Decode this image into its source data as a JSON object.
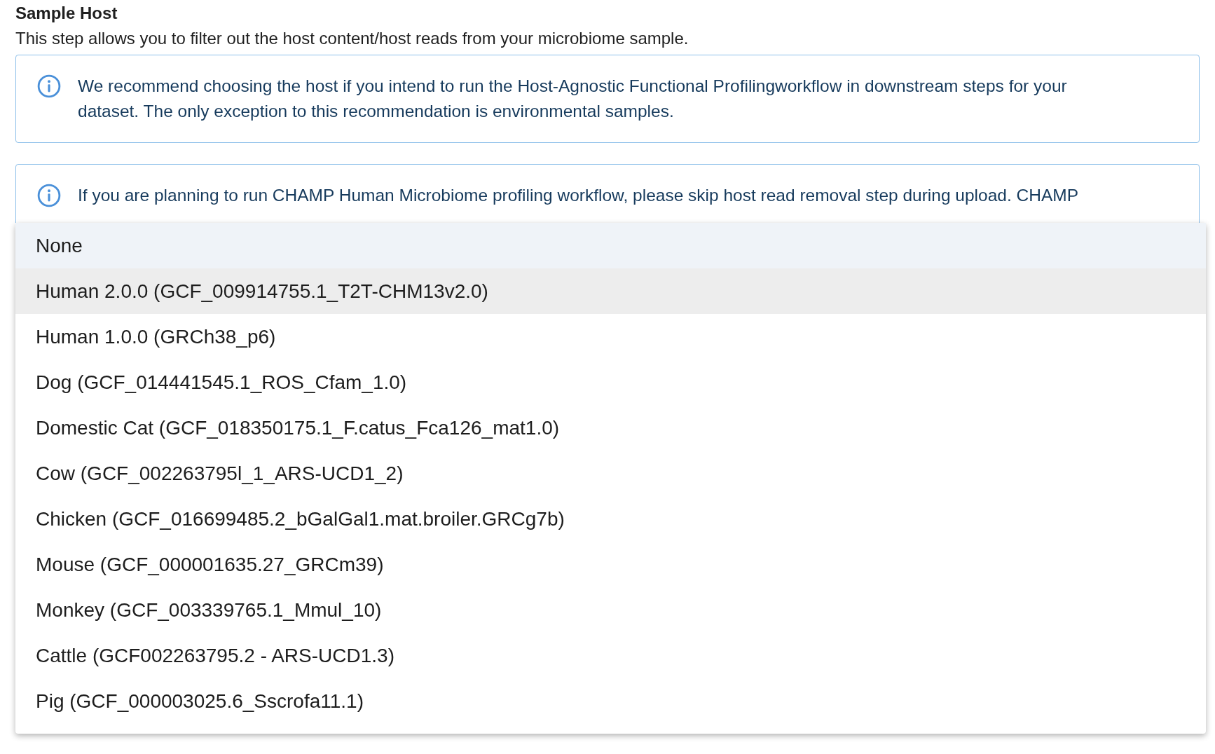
{
  "section": {
    "title": "Sample Host",
    "description": "This step allows you to filter out the host content/host reads from your microbiome sample."
  },
  "notices": [
    {
      "text": "We recommend choosing the host if you intend to run the Host-Agnostic Functional Profilingworkflow in downstream steps for your dataset. The only exception to this recommendation is environmental samples."
    },
    {
      "text": "If you are planning to run CHAMP Human Microbiome profiling workflow, please skip host read removal step during upload. CHAMP"
    }
  ],
  "dropdown": {
    "options": [
      {
        "label": "None",
        "selected": true,
        "hovered": false
      },
      {
        "label": "Human 2.0.0 (GCF_009914755.1_T2T-CHM13v2.0)",
        "selected": false,
        "hovered": true
      },
      {
        "label": "Human 1.0.0 (GRCh38_p6)",
        "selected": false,
        "hovered": false
      },
      {
        "label": "Dog (GCF_014441545.1_ROS_Cfam_1.0)",
        "selected": false,
        "hovered": false
      },
      {
        "label": "Domestic Cat (GCF_018350175.1_F.catus_Fca126_mat1.0)",
        "selected": false,
        "hovered": false
      },
      {
        "label": "Cow (GCF_002263795l_1_ARS-UCD1_2)",
        "selected": false,
        "hovered": false
      },
      {
        "label": "Chicken (GCF_016699485.2_bGalGal1.mat.broiler.GRCg7b)",
        "selected": false,
        "hovered": false
      },
      {
        "label": "Mouse (GCF_000001635.27_GRCm39)",
        "selected": false,
        "hovered": false
      },
      {
        "label": "Monkey (GCF_003339765.1_Mmul_10)",
        "selected": false,
        "hovered": false
      },
      {
        "label": "Cattle (GCF002263795.2 - ARS-UCD1.3)",
        "selected": false,
        "hovered": false
      },
      {
        "label": "Pig (GCF_000003025.6_Sscrofa11.1)",
        "selected": false,
        "hovered": false
      }
    ]
  }
}
